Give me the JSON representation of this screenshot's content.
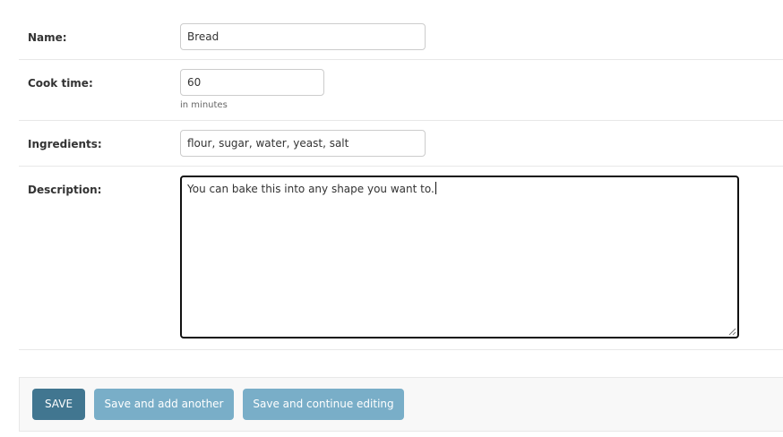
{
  "form": {
    "name": {
      "label": "Name:",
      "value": "Bread"
    },
    "cook_time": {
      "label": "Cook time:",
      "value": "60",
      "help": "in minutes"
    },
    "ingredients": {
      "label": "Ingredients:",
      "value": "flour, sugar, water, yeast, salt"
    },
    "description": {
      "label": "Description:",
      "value": "You can bake this into any shape you want to."
    }
  },
  "actions": {
    "save": "SAVE",
    "save_add_another": "Save and add another",
    "save_continue": "Save and continue editing"
  },
  "colors": {
    "primary_button": "#417690",
    "secondary_button": "#79aec8"
  }
}
